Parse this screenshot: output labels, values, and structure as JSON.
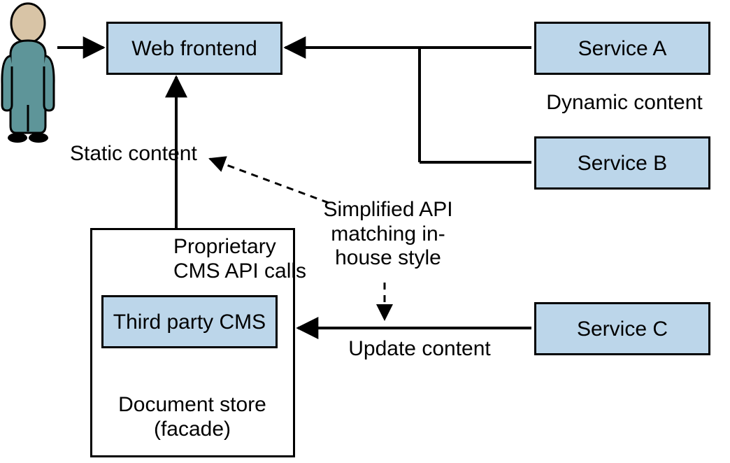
{
  "boxes": {
    "web_frontend": "Web frontend",
    "service_a": "Service A",
    "service_b": "Service B",
    "service_c": "Service C",
    "third_party_cms": "Third party CMS"
  },
  "labels": {
    "dynamic_content": "Dynamic content",
    "static_content": "Static content",
    "proprietary_l1": "Proprietary",
    "proprietary_l2": "CMS API calls",
    "simplified_l1": "Simplified API",
    "simplified_l2": "matching in-",
    "simplified_l3": "house style",
    "update_content": "Update content",
    "doc_store_l1": "Document store",
    "doc_store_l2": "(facade)"
  },
  "colors": {
    "box_fill": "#bcd6ea",
    "person_body": "#5e9599",
    "person_skin": "#d8c4a6"
  }
}
